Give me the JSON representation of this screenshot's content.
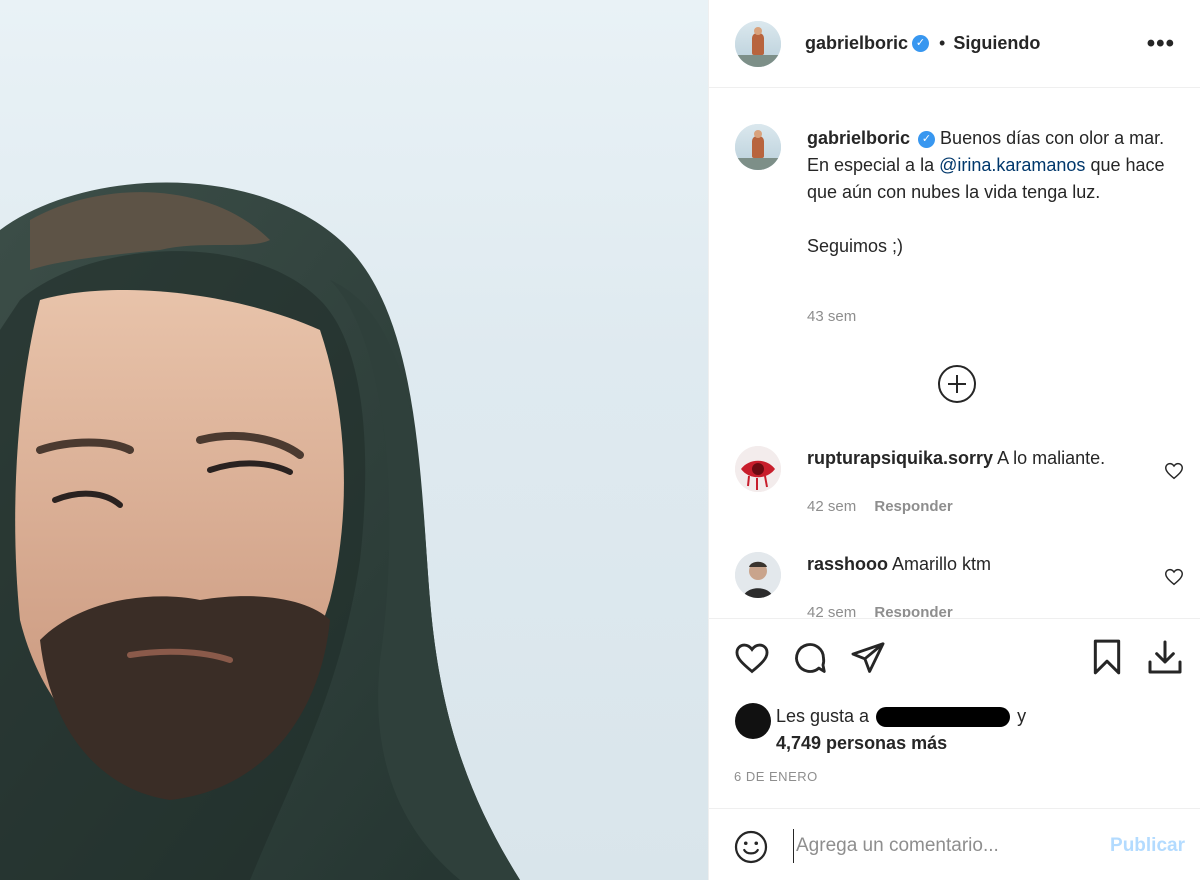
{
  "header": {
    "username": "gabrielboric",
    "verified_glyph": "✓",
    "separator": "•",
    "follow_status": "Siguiendo",
    "more_glyph": "•••"
  },
  "caption": {
    "username": "gabrielboric",
    "verified_glyph": "✓",
    "text_before_mention": "Buenos días con olor a mar. En especial a la ",
    "mention": "@irina.karamanos",
    "text_after_mention": " que hace que aún con nubes la vida tenga luz.",
    "text_second_paragraph": "Seguimos ;)",
    "time": "43 sem"
  },
  "comments": [
    {
      "username": "rupturapsiquika.sorry",
      "text": "A lo maliante.",
      "time": "42 sem",
      "reply_label": "Responder"
    },
    {
      "username": "rasshooo",
      "text": "Amarillo ktm",
      "time": "42 sem",
      "reply_label": "Responder"
    }
  ],
  "likes": {
    "prefix": "Les gusta a",
    "suffix": "y",
    "count_text": "4,749 personas más"
  },
  "post_date": "6 DE ENERO",
  "comment_box": {
    "placeholder": "Agrega un comentario...",
    "publish_label": "Publicar"
  },
  "icons": {
    "like": "heart-icon",
    "comment": "comment-icon",
    "share": "paper-plane-icon",
    "save": "bookmark-icon",
    "download": "download-icon",
    "emoji": "emoji-icon",
    "load_more": "plus-circle-icon",
    "more": "ellipsis-icon"
  },
  "colors": {
    "text": "#262626",
    "secondary": "#8e8e8e",
    "verified": "#3897f0",
    "mention": "#00376b",
    "publish_disabled": "#b3dbff",
    "border": "#efefef"
  }
}
